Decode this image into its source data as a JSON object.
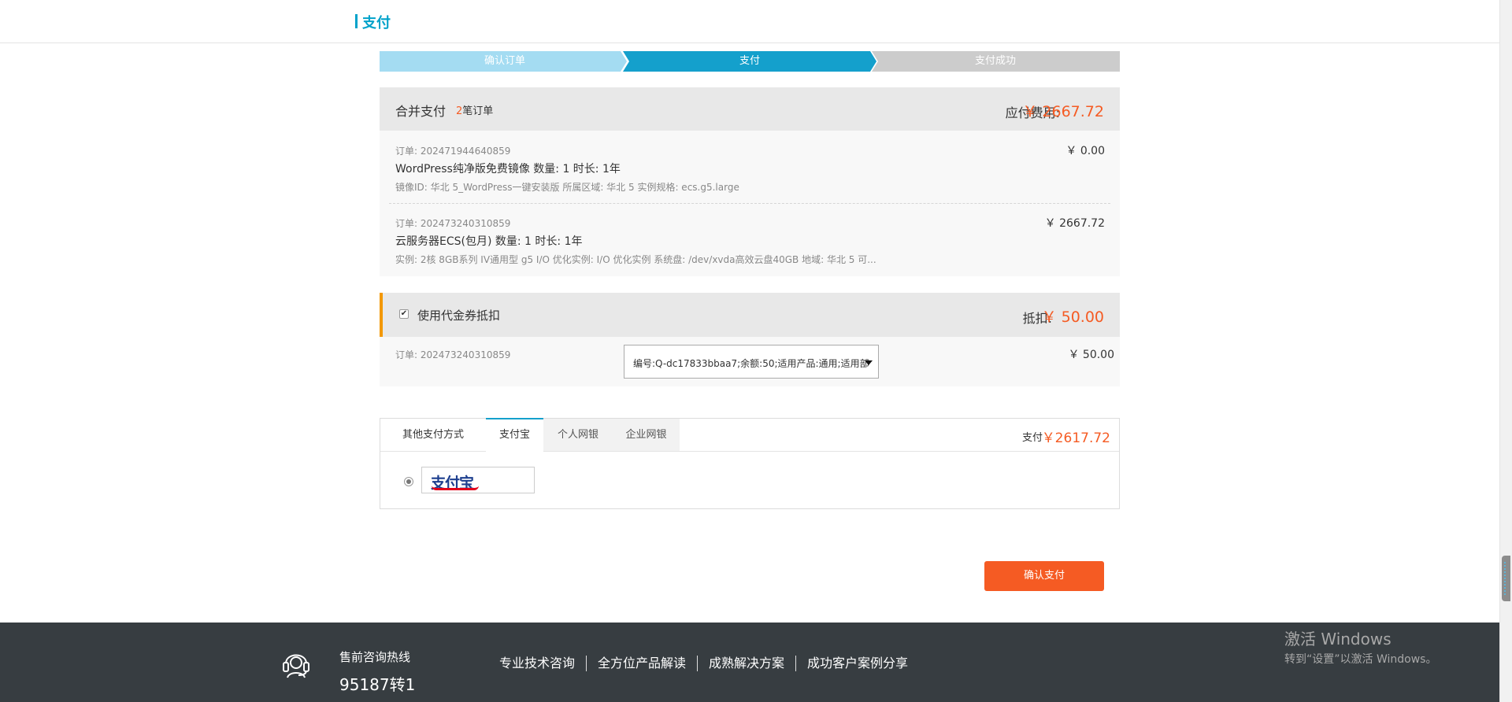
{
  "header": {
    "title": "支付"
  },
  "steps": [
    "确认订单",
    "支付",
    "支付成功"
  ],
  "merge": {
    "title": "合并支付",
    "count_num": "2",
    "count_suffix": "笔订单",
    "due_label": "应付费用:",
    "due_value": "￥ 2667.72"
  },
  "orders": [
    {
      "id": "订单:   202471944640859",
      "name": "WordPress纯净版免费镜像 数量: 1 时长: 1年",
      "desc": "镜像ID: 华北 5_WordPress一键安装版 所属区域: 华北 5 实例规格: ecs.g5.large",
      "price": "￥ 0.00"
    },
    {
      "id": "订单:   202473240310859",
      "name": "云服务器ECS(包月) 数量: 1 时长: 1年",
      "desc": "实例: 2核 8GB系列 IV通用型 g5 I/O 优化实例: I/O 优化实例 系统盘: /dev/xvda高效云盘40GB 地域: 华北 5 可...",
      "price": "￥ 2667.72"
    }
  ],
  "voucher": {
    "checked_mark": "✔",
    "title": "使用代金券抵扣",
    "deduct_label": "抵扣:",
    "deduct_value": "￥ 50.00",
    "order": "订单:   202473240310859",
    "selected_option": "编号:Q-dc17833bbaa7;余额:50;适用产品:通用;适用部",
    "price": "￥ 50.00"
  },
  "payment": {
    "tabs": [
      "其他支付方式",
      "支付宝",
      "个人网银",
      "企业网银"
    ],
    "active_tab": "支付宝",
    "pay_label": "支付",
    "pay_value": "￥2617.72",
    "alipay_logo": "支付宝"
  },
  "confirm_label": "确认支付",
  "footer": {
    "hotline_label": "售前咨询热线",
    "hotline_number": "95187转1",
    "links": [
      "专业技术咨询",
      "全方位产品解读",
      "成熟解决方案",
      "成功客户案例分享"
    ]
  },
  "watermark": {
    "title": "激活 Windows",
    "sub": "转到“设置”以激活 Windows。"
  },
  "colors": {
    "accent": "#14a0cc",
    "price": "#f55b23",
    "footer_bg": "#373d41"
  }
}
